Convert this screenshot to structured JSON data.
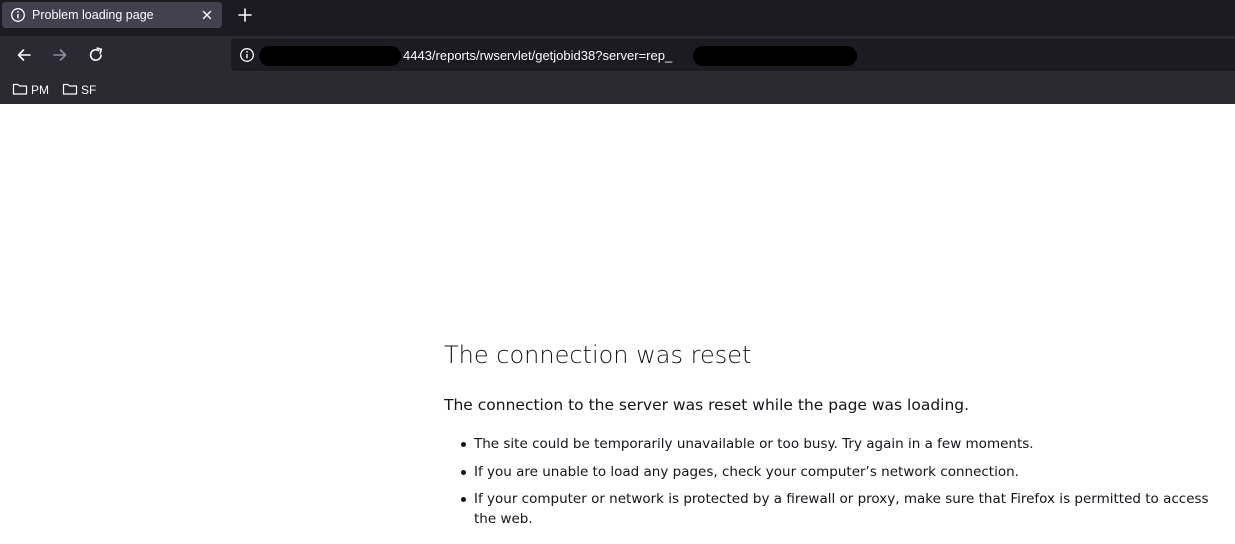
{
  "tab": {
    "title": "Problem loading page",
    "icon": "info-icon"
  },
  "toolbar": {
    "back_icon": "back-arrow-icon",
    "forward_icon": "forward-arrow-icon",
    "reload_icon": "reload-icon",
    "new_tab_icon": "plus-icon"
  },
  "urlbar": {
    "visible_url": "4443/reports/rwservlet/getjobid38?server=rep_"
  },
  "bookmarks": [
    {
      "label": "PM",
      "icon": "folder-icon"
    },
    {
      "label": "SF",
      "icon": "folder-icon"
    }
  ],
  "error": {
    "title": "The connection was reset",
    "short_desc": "The connection to the server was reset while the page was loading.",
    "bullets": [
      "The site could be temporarily unavailable or too busy. Try again in a few moments.",
      "If you are unable to load any pages, check your computer’s network connection.",
      "If your computer or network is protected by a firewall or proxy, make sure that Firefox is permitted to access the web."
    ]
  },
  "colors": {
    "tabstrip_bg": "#1c1b22",
    "toolbar_bg": "#2b2a33",
    "active_tab_bg": "#42414d",
    "urlbar_bg": "#1c1b22",
    "chrome_text": "#fbfbfe",
    "page_text": "#15141a",
    "redaction": "#000000"
  }
}
